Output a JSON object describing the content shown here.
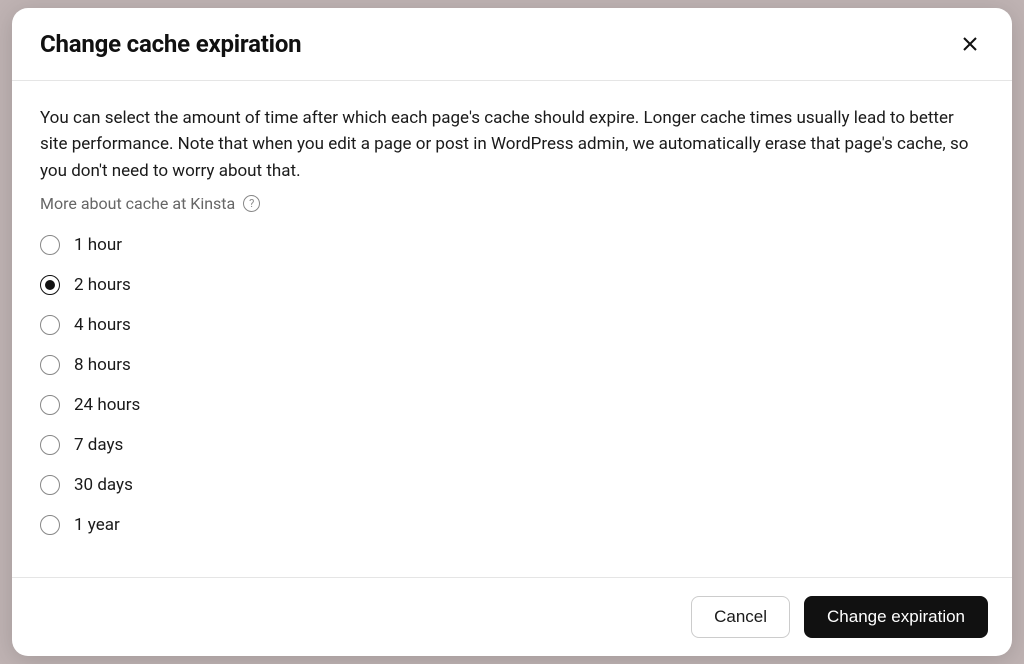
{
  "modal": {
    "title": "Change cache expiration",
    "description": "You can select the amount of time after which each page's cache should expire. Longer cache times usually lead to better site performance. Note that when you edit a page or post in WordPress admin, we automatically erase that page's cache, so you don't need to worry about that.",
    "more_link": "More about cache at Kinsta",
    "options": [
      {
        "label": "1 hour",
        "selected": false
      },
      {
        "label": "2 hours",
        "selected": true
      },
      {
        "label": "4 hours",
        "selected": false
      },
      {
        "label": "8 hours",
        "selected": false
      },
      {
        "label": "24 hours",
        "selected": false
      },
      {
        "label": "7 days",
        "selected": false
      },
      {
        "label": "30 days",
        "selected": false
      },
      {
        "label": "1 year",
        "selected": false
      }
    ],
    "footer": {
      "cancel": "Cancel",
      "confirm": "Change expiration"
    }
  }
}
